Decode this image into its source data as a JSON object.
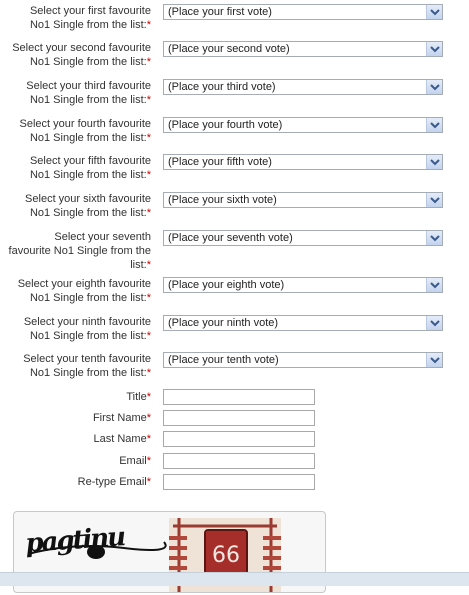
{
  "votes": [
    {
      "label_line1": "Select your first favourite",
      "label_line2": "No1 Single from the list:",
      "value": "(Place your first vote)"
    },
    {
      "label_line1": "Select your second favourite",
      "label_line2": "No1 Single from the list:",
      "value": "(Place your second vote)"
    },
    {
      "label_line1": "Select your third favourite",
      "label_line2": "No1 Single from the list:",
      "value": "(Place your third vote)"
    },
    {
      "label_line1": "Select your fourth favourite",
      "label_line2": "No1 Single from the list:",
      "value": "(Place your fourth vote)"
    },
    {
      "label_line1": "Select your fifth favourite",
      "label_line2": "No1 Single from the list:",
      "value": "(Place your fifth vote)"
    },
    {
      "label_line1": "Select your sixth favourite",
      "label_line2": "No1 Single from the list:",
      "value": "(Place your sixth vote)"
    },
    {
      "label_line1": "Select your seventh",
      "label_line2": "favourite No1 Single from the",
      "label_line3": "list:",
      "value": "(Place your seventh vote)"
    },
    {
      "label_line1": "Select your eighth favourite",
      "label_line2": "No1 Single from the list:",
      "value": "(Place your eighth vote)"
    },
    {
      "label_line1": "Select your ninth favourite",
      "label_line2": "No1 Single from the list:",
      "value": "(Place your ninth vote)"
    },
    {
      "label_line1": "Select your tenth favourite",
      "label_line2": "No1 Single from the list:",
      "value": "(Place your tenth vote)"
    }
  ],
  "fields": {
    "title": "Title",
    "first_name": "First Name",
    "last_name": "Last Name",
    "email": "Email",
    "retype_email": "Re-type Email"
  },
  "required_marker": "*",
  "captcha": {
    "text": "pagtinu",
    "number": "66"
  },
  "icons": {
    "dropdown": "chevron-down-icon"
  },
  "colors": {
    "required": "#cc0000",
    "dropdown_button": "#c3d3ee",
    "chevron": "#3a5a8c"
  }
}
